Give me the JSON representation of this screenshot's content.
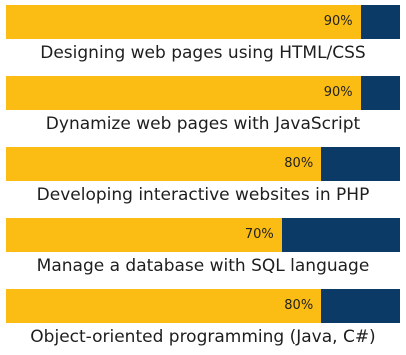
{
  "colors": {
    "fill": "#fbbd13",
    "track": "#0b3a66",
    "text": "#1e1e1e"
  },
  "skills": [
    {
      "percent_label": "90%",
      "percent": 90,
      "label": "Designing web pages using HTML/CSS"
    },
    {
      "percent_label": "90%",
      "percent": 90,
      "label": "Dynamize web pages with JavaScript"
    },
    {
      "percent_label": "80%",
      "percent": 80,
      "label": "Developing interactive websites in PHP"
    },
    {
      "percent_label": "70%",
      "percent": 70,
      "label": "Manage a database with SQL language"
    },
    {
      "percent_label": "80%",
      "percent": 80,
      "label": "Object-oriented programming (Java, C#)"
    }
  ]
}
